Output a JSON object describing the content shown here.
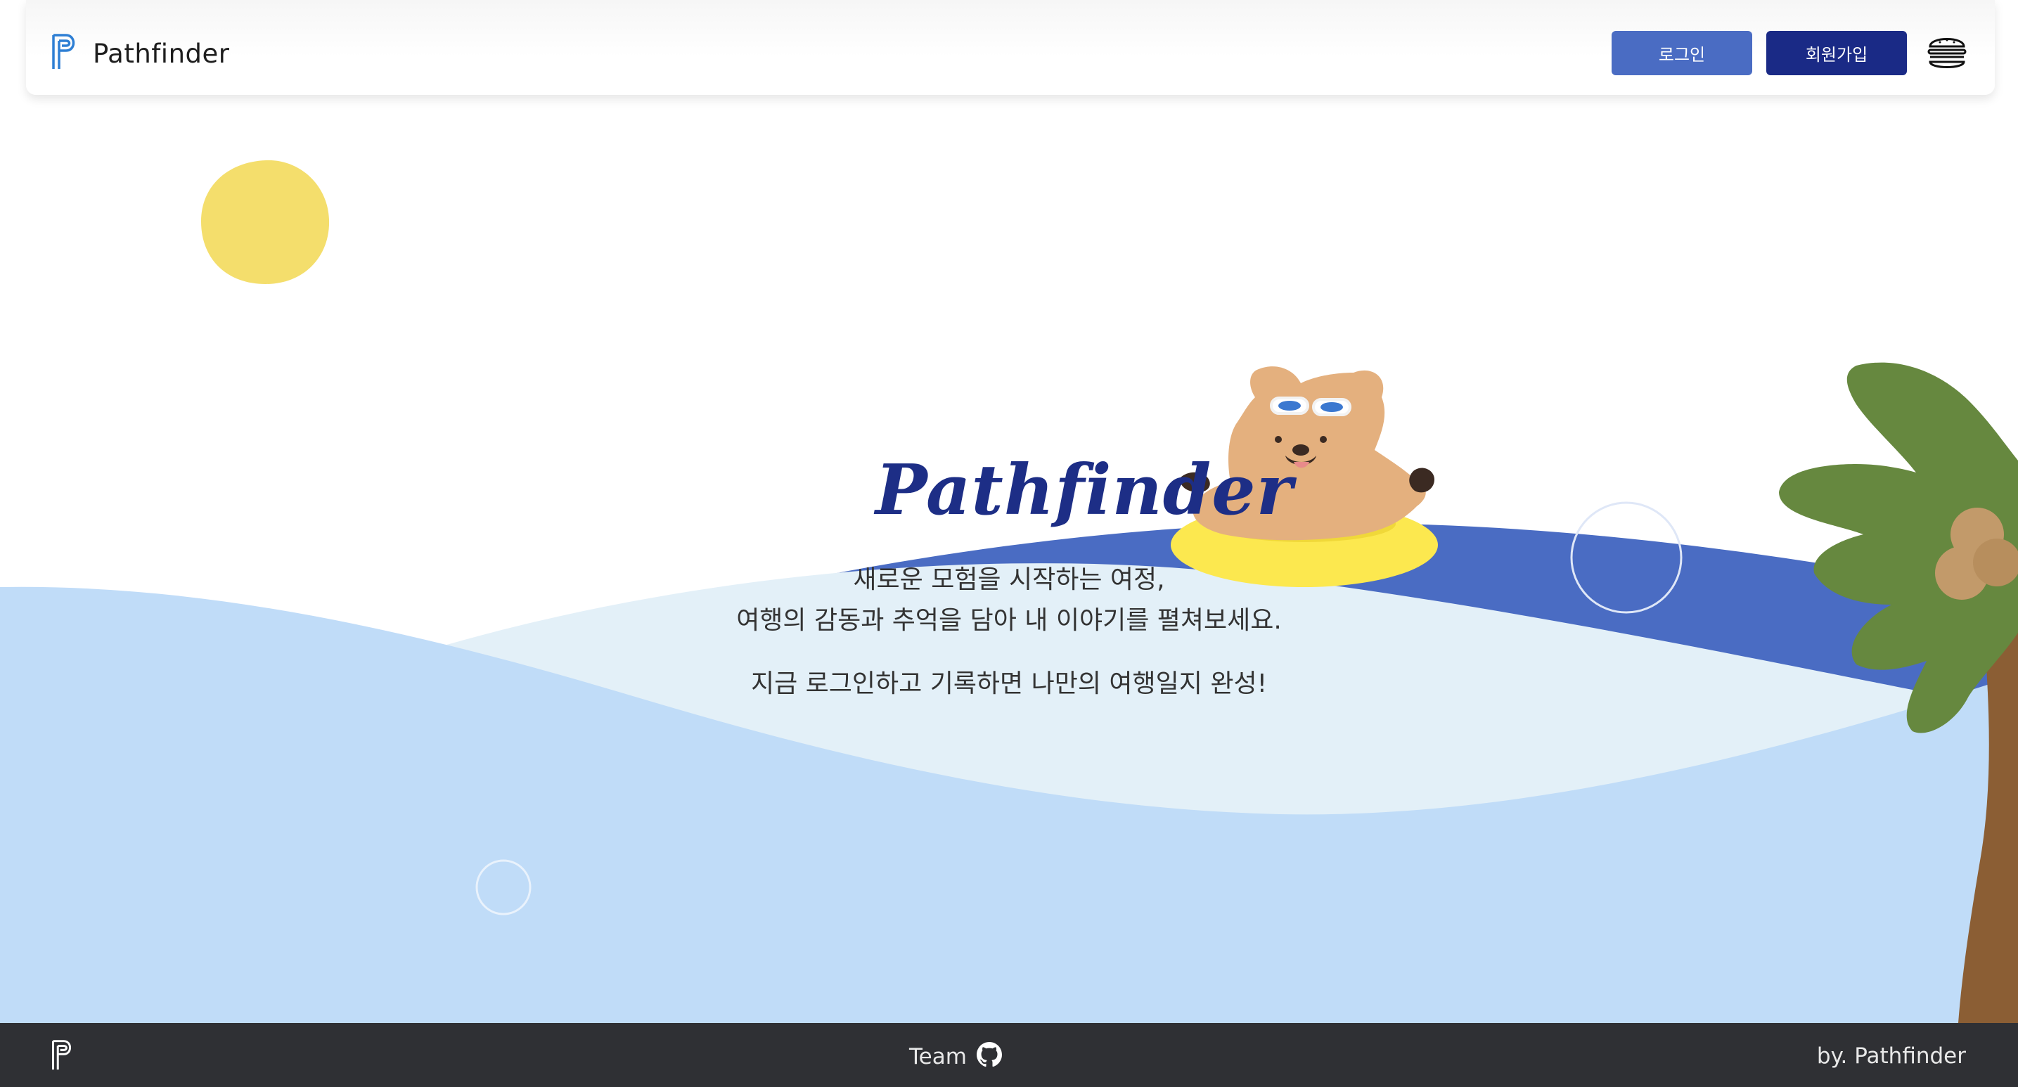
{
  "header": {
    "brand": "Pathfinder",
    "login_label": "로그인",
    "signup_label": "회원가입",
    "menu_icon": "hamburger-icon"
  },
  "hero": {
    "title": "Pathfinder",
    "line1": "새로운 모험을 시작하는 여정,",
    "line2": "여행의 감동과 추억을 담아 내 이야기를 펼쳐보세요.",
    "line3": "지금 로그인하고 기록하면 나만의 여행일지 완성!"
  },
  "footer": {
    "team_label": "Team",
    "team_icon": "github-icon",
    "byline": "by. Pathfinder"
  },
  "colors": {
    "primary_dark": "#1a2a86",
    "primary": "#4a6cc3",
    "sea_light": "#c0dcf8",
    "sea_dark": "#4a6cc3",
    "sun": "#f4de6c",
    "footer_bg": "#2f3034"
  }
}
